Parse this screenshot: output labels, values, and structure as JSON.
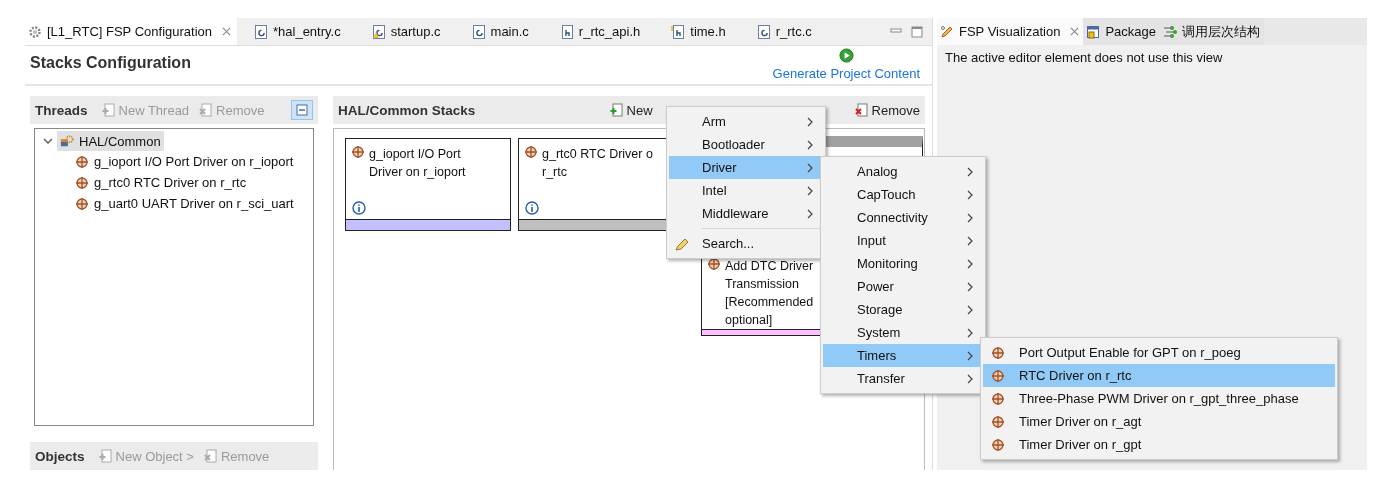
{
  "editor_tabs": [
    {
      "label": "[L1_RTC] FSP Configuration",
      "kind": "gear",
      "selected": true,
      "closable": true
    },
    {
      "label": "*hal_entry.c",
      "kind": "c",
      "selected": false,
      "closable": false
    },
    {
      "label": "startup.c",
      "kind": "c-warning",
      "selected": false,
      "closable": false
    },
    {
      "label": "main.c",
      "kind": "c",
      "selected": false,
      "closable": false
    },
    {
      "label": "r_rtc_api.h",
      "kind": "h",
      "selected": false,
      "closable": false
    },
    {
      "label": "time.h",
      "kind": "h-folder",
      "selected": false,
      "closable": false
    },
    {
      "label": "r_rtc.c",
      "kind": "c",
      "selected": false,
      "closable": false
    }
  ],
  "editor_header": {
    "title": "Stacks Configuration",
    "action": "Generate Project Content"
  },
  "threads_panel": {
    "title": "Threads",
    "actions": [
      {
        "label": "New Thread",
        "disabled": true
      },
      {
        "label": "Remove",
        "disabled": true
      }
    ],
    "tree": [
      {
        "label": "HAL/Common",
        "expanded": true,
        "selected": true,
        "children": [
          {
            "label": "g_ioport I/O Port Driver on r_ioport",
            "selected": false
          },
          {
            "label": "g_rtc0 RTC Driver on r_rtc",
            "selected": false
          },
          {
            "label": "g_uart0 UART Driver on r_sci_uart",
            "selected": false
          }
        ]
      }
    ]
  },
  "objects_panel": {
    "title": "Objects",
    "actions": [
      {
        "label": "New Object >",
        "disabled": true
      },
      {
        "label": "Remove",
        "disabled": true
      }
    ]
  },
  "stacks_panel": {
    "title": "HAL/Common Stacks",
    "actions": [
      {
        "label": "New",
        "kind": "new"
      },
      {
        "label": "Remove",
        "kind": "remove"
      }
    ],
    "stacks": [
      {
        "lines": [
          "g_ioport I/O Port",
          "Driver on r_ioport"
        ],
        "info": true,
        "color": "#c4c0ff"
      },
      {
        "lines": [
          "g_rtc0 RTC Driver o",
          "r_rtc"
        ],
        "info": true,
        "color": "#c0c0c0"
      },
      {
        "lines": [
          "Add DTC Driver",
          "Transmission",
          "[Recommended",
          "optional]"
        ],
        "info": false,
        "color": "#ffc0ff"
      }
    ]
  },
  "context_menu": {
    "items": [
      {
        "label": "Arm",
        "kind": "submenu",
        "selected": false
      },
      {
        "label": "Bootloader",
        "kind": "submenu",
        "selected": false
      },
      {
        "label": "Driver",
        "kind": "submenu",
        "selected": true
      },
      {
        "label": "Intel",
        "kind": "submenu",
        "selected": false
      },
      {
        "label": "Middleware",
        "kind": "submenu",
        "selected": false
      },
      {
        "label": "Search...",
        "kind": "search",
        "selected": false
      }
    ]
  },
  "driver_menu": {
    "items": [
      {
        "label": "Analog",
        "selected": false
      },
      {
        "label": "CapTouch",
        "selected": false
      },
      {
        "label": "Connectivity",
        "selected": false
      },
      {
        "label": "Input",
        "selected": false
      },
      {
        "label": "Monitoring",
        "selected": false
      },
      {
        "label": "Power",
        "selected": false
      },
      {
        "label": "Storage",
        "selected": false
      },
      {
        "label": "System",
        "selected": false
      },
      {
        "label": "Timers",
        "selected": true
      },
      {
        "label": "Transfer",
        "selected": false
      }
    ]
  },
  "timers_menu": {
    "items": [
      {
        "label": "Port Output Enable for GPT on r_poeg",
        "selected": false
      },
      {
        "label": "RTC Driver on r_rtc",
        "selected": true
      },
      {
        "label": "Three-Phase PWM Driver on r_gpt_three_phase",
        "selected": false
      },
      {
        "label": "Timer Driver on r_agt",
        "selected": false
      },
      {
        "label": "Timer Driver on r_gpt",
        "selected": false
      }
    ]
  },
  "view_tabs": [
    {
      "label": "FSP Visualization",
      "kind": "pencil",
      "selected": true,
      "closable": true
    },
    {
      "label": "Package",
      "kind": "chip",
      "selected": false,
      "closable": false
    },
    {
      "label": "调用层次结构",
      "kind": "hierarchy",
      "selected": false,
      "closable": false
    }
  ],
  "view_message": "The active editor element does not use this view"
}
